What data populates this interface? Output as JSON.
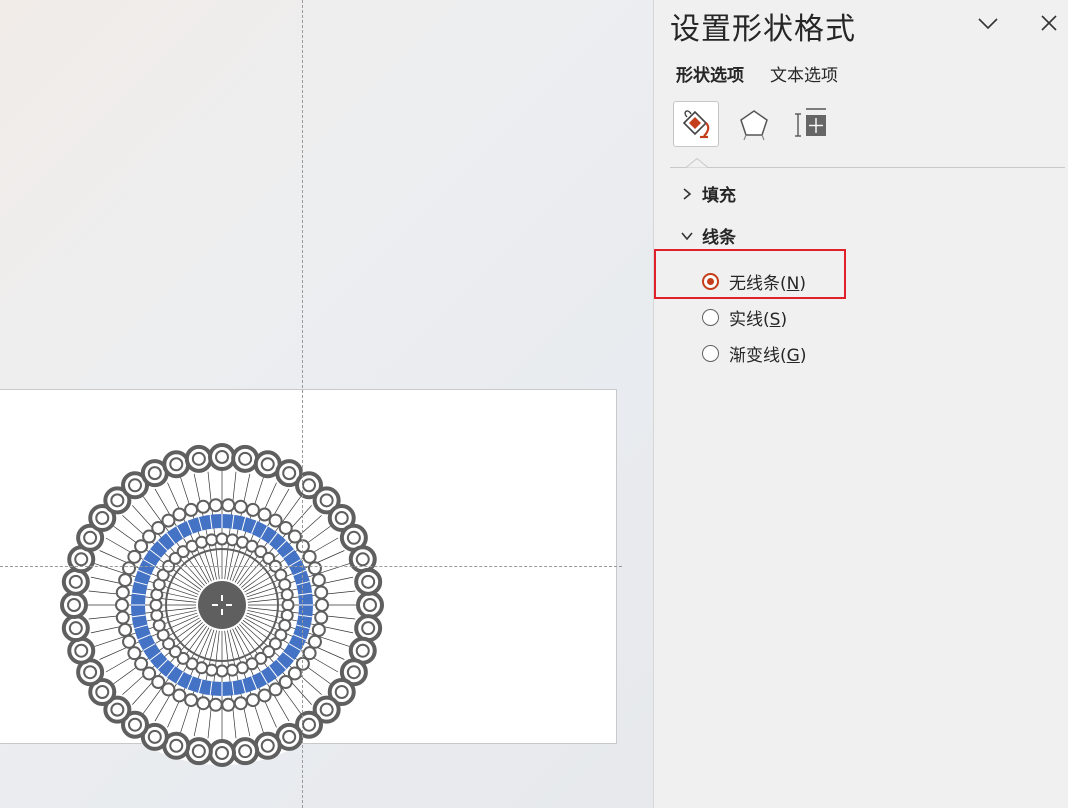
{
  "pane": {
    "title": "设置形状格式",
    "tabs": [
      {
        "label": "形状选项",
        "active": true
      },
      {
        "label": "文本选项",
        "active": false
      }
    ],
    "icon_tabs": [
      {
        "icon": "fill-line-bucket-icon",
        "active": true
      },
      {
        "icon": "pentagon-effects-icon",
        "active": false
      },
      {
        "icon": "size-properties-icon",
        "active": false
      }
    ],
    "sections": [
      {
        "label": "填充",
        "expanded": false
      },
      {
        "label": "线条",
        "expanded": true
      }
    ],
    "line_options": [
      {
        "prefix": "无线条(",
        "key": "N",
        "suffix": ")",
        "selected": true
      },
      {
        "prefix": "实线(",
        "key": "S",
        "suffix": ")",
        "selected": false
      },
      {
        "prefix": "渐变线(",
        "key": "G",
        "suffix": ")",
        "selected": false
      }
    ]
  },
  "colors": {
    "accent": "#c43e1c",
    "highlight_box": "#e0202a",
    "shape_gray": "#5f5f5f",
    "shape_blue": "#4472c4"
  }
}
